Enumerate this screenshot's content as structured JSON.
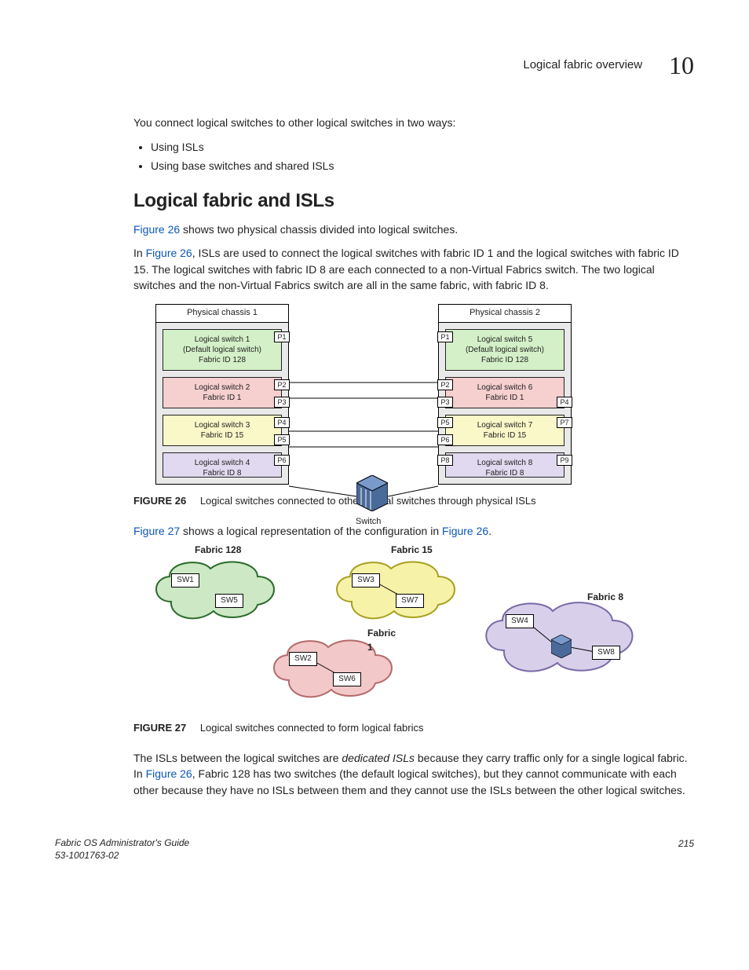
{
  "head": {
    "title": "Logical fabric overview",
    "chapter": "10"
  },
  "intro": "You connect logical switches to other logical switches in two ways:",
  "bullets": [
    "Using ISLs",
    "Using base switches and shared ISLs"
  ],
  "section_heading": "Logical fabric and ISLs",
  "p1a": "Figure 26",
  "p1b": " shows two physical chassis divided into logical switches.",
  "p2a": "In ",
  "p2b": "Figure 26",
  "p2c": ", ISLs are used to connect the logical switches with fabric ID 1 and the logical switches with fabric ID 15. The logical switches with fabric ID 8 are each connected to a non-Virtual Fabrics switch. The two logical switches and the non-Virtual Fabrics switch are all in the same fabric, with fabric ID 8.",
  "fig26": {
    "label": "FIGURE 26",
    "caption": "Logical switches connected to other logical switches through physical ISLs",
    "chassis1": {
      "title": "Physical chassis 1",
      "ls1": {
        "l1": "Logical switch 1",
        "l2": "(Default logical switch)",
        "l3": "Fabric ID 128",
        "port": "P1"
      },
      "ls2": {
        "l1": "Logical switch 2",
        "l2": "Fabric ID 1",
        "pa": "P2",
        "pb": "P3"
      },
      "ls3": {
        "l1": "Logical switch 3",
        "l2": "Fabric ID 15",
        "pa": "P4",
        "pb": "P5"
      },
      "ls4": {
        "l1": "Logical switch 4",
        "l2": "Fabric ID 8",
        "pa": "P6"
      }
    },
    "chassis2": {
      "title": "Physical chassis 2",
      "ls5": {
        "l1": "Logical switch 5",
        "l2": "(Default logical switch)",
        "l3": "Fabric ID 128",
        "port": "P1"
      },
      "ls6": {
        "l1": "Logical switch 6",
        "l2": "Fabric ID 1",
        "pa": "P2",
        "pb": "P3",
        "pc": "P4"
      },
      "ls7": {
        "l1": "Logical switch 7",
        "l2": "Fabric ID 15",
        "pa": "P5",
        "pb": "P6",
        "pc": "P7"
      },
      "ls8": {
        "l1": "Logical switch 8",
        "l2": "Fabric ID 8",
        "pa": "P8",
        "pb": "P9"
      }
    },
    "switch_label": "Switch"
  },
  "p3a": "Figure 27",
  "p3b": " shows a logical representation of the configuration in ",
  "p3c": "Figure 26",
  "p3d": ".",
  "fig27": {
    "label": "FIGURE 27",
    "caption": "Logical switches connected to form logical fabrics",
    "f128": {
      "title": "Fabric 128",
      "a": "SW1",
      "b": "SW5"
    },
    "f15": {
      "title": "Fabric 15",
      "a": "SW3",
      "b": "SW7"
    },
    "f1": {
      "title": "Fabric 1",
      "a": "SW2",
      "b": "SW6"
    },
    "f8": {
      "title": "Fabric 8",
      "a": "SW4",
      "b": "SW8"
    }
  },
  "p4a": "The ISLs between the logical switches are ",
  "p4b": "dedicated ISLs",
  "p4c": " because they carry traffic only for a single logical fabric. In ",
  "p4d": "Figure 26",
  "p4e": ", Fabric 128 has two switches (the default logical switches), but they cannot communicate with each other because they have no ISLs between them and they cannot use the ISLs between the other logical switches.",
  "footer": {
    "guide": "Fabric OS Administrator's Guide",
    "docnum": "53-1001763-02",
    "page": "215"
  }
}
